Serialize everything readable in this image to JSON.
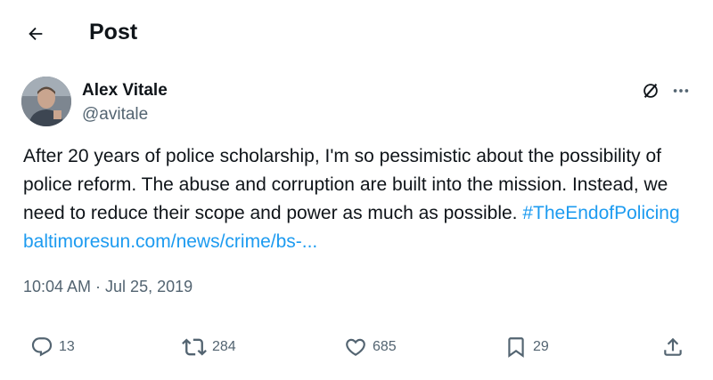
{
  "header": {
    "back_icon": "arrow-left-icon",
    "title": "Post"
  },
  "tweet": {
    "author": {
      "display_name": "Alex Vitale",
      "handle": "@avitale",
      "avatar_icon": "user-avatar"
    },
    "text_plain": "After 20 years of police scholarship, I'm so pessimistic about the possibility of police reform. The abuse and corruption are built into the mission. Instead, we need to reduce their scope and power as much as possible. ",
    "hashtag": "#TheEndofPolicing",
    "link": "baltimoresun.com/news/crime/bs-...",
    "timestamp": "10:04 AM · Jul 25, 2019",
    "link_color": "#1d9bf0"
  },
  "actions": {
    "reply": {
      "icon": "reply-icon",
      "count": "13"
    },
    "repost": {
      "icon": "repost-icon",
      "count": "284"
    },
    "like": {
      "icon": "heart-icon",
      "count": "685"
    },
    "bookmark": {
      "icon": "bookmark-icon",
      "count": "29"
    },
    "share": {
      "icon": "share-icon"
    }
  },
  "menu": {
    "grok_icon": "grok-icon",
    "more_icon": "more-icon"
  }
}
